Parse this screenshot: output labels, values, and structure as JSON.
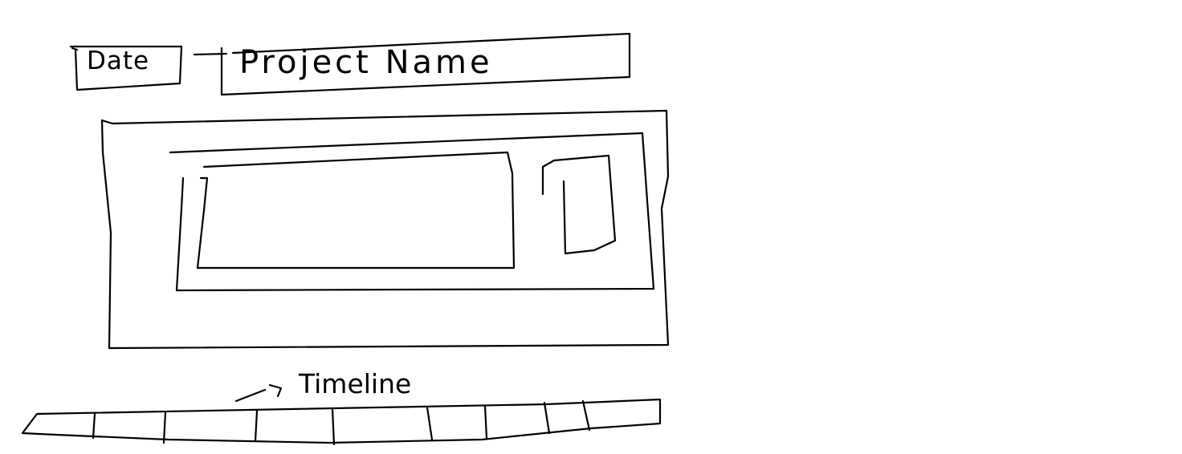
{
  "header": {
    "date_label": "Date",
    "project_name_label": "Project Name"
  },
  "timeline": {
    "label": "Timeline",
    "segment_count": 9
  },
  "colors": {
    "ink": "#000000",
    "background": "#ffffff"
  }
}
